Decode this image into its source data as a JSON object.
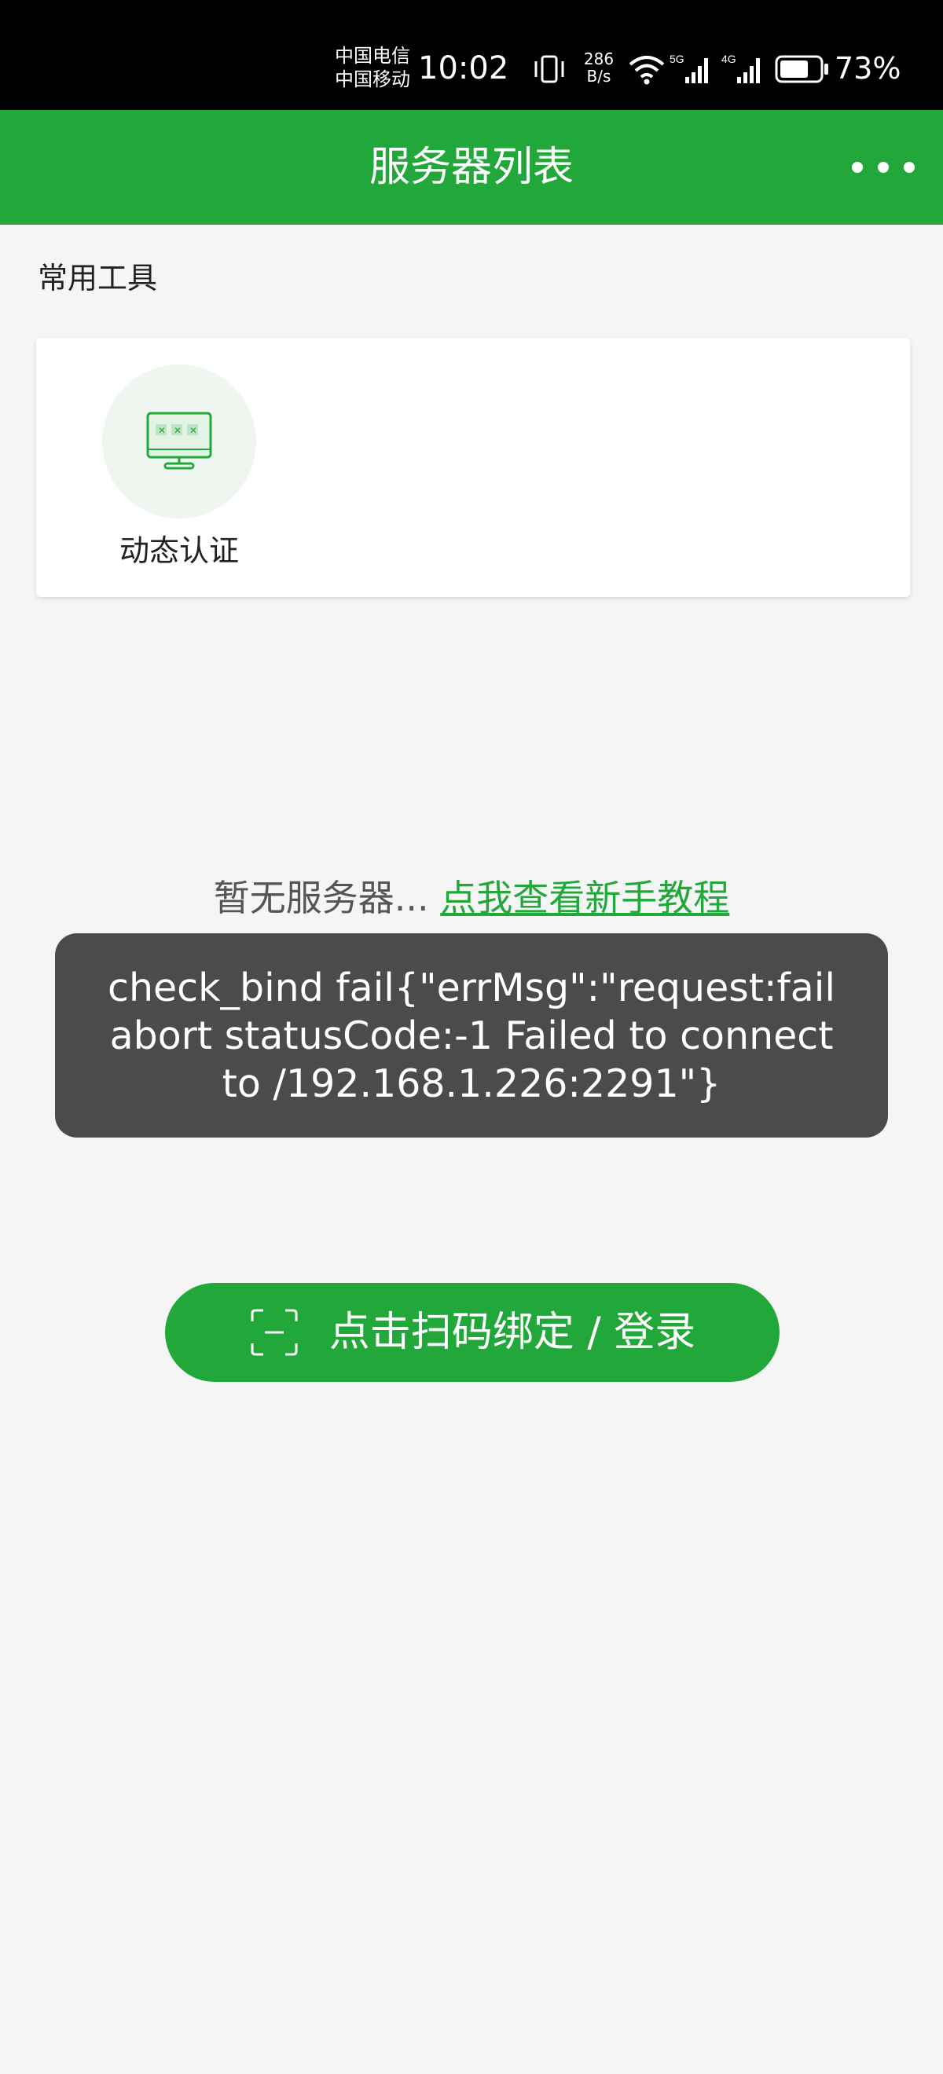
{
  "status_bar": {
    "carrier_1": "中国电信",
    "carrier_2": "中国移动",
    "time": "10:02",
    "net_speed_value": "286",
    "net_speed_unit": "B/s",
    "signal_1_label": "5G",
    "signal_2_label": "4G",
    "battery_percent": "73%",
    "battery_level": 0.73
  },
  "header": {
    "title": "服务器列表",
    "more_icon": "ellipsis-icon"
  },
  "tools_section": {
    "title": "常用工具",
    "items": [
      {
        "label": "动态认证",
        "icon": "monitor-password-icon"
      }
    ]
  },
  "empty_state": {
    "text": "暂无服务器...",
    "link_text": "点我查看新手教程"
  },
  "toast": {
    "message": "check_bind fail{\"errMsg\":\"request:fail abort statusCode:-1 Failed to connect to /192.168.1.226:2291\"}"
  },
  "scan_button": {
    "icon": "scan-icon",
    "label": "点击扫码绑定 / 登录"
  },
  "colors": {
    "brand_green": "#22a83a",
    "toast_bg": "#4b4b4b",
    "page_bg": "#f5f5f5"
  }
}
